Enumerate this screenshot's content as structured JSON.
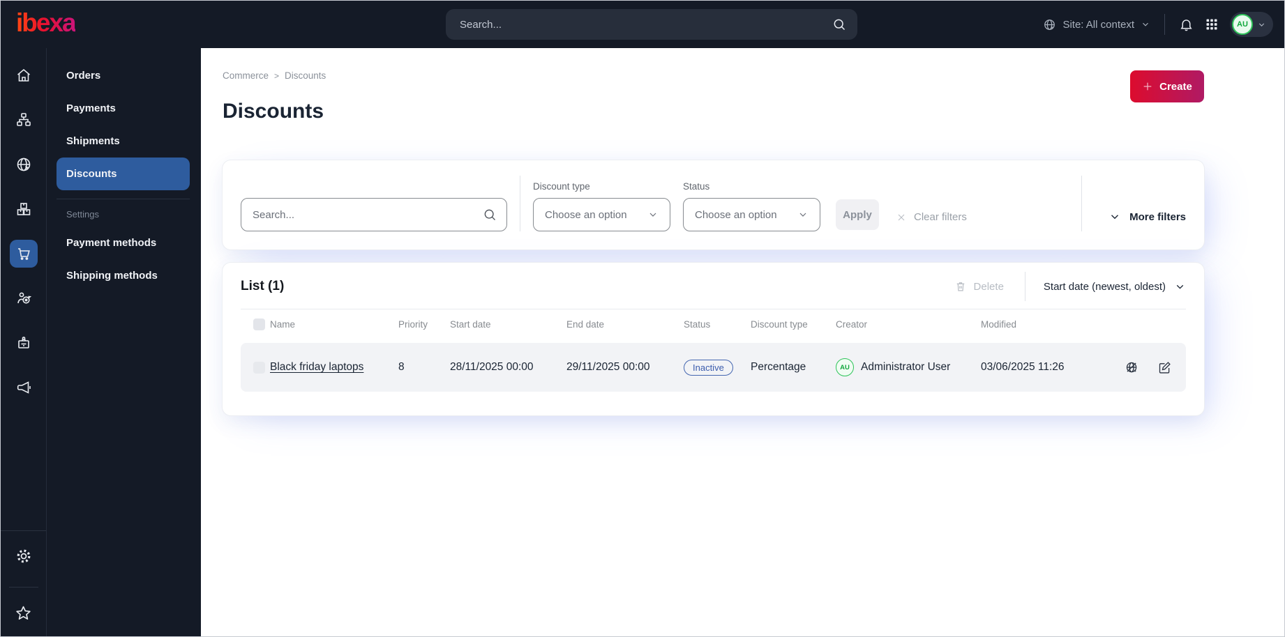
{
  "topbar": {
    "logo": "ibexa",
    "search_placeholder": "Search...",
    "site_context": "Site: All context",
    "avatar_initials": "AU"
  },
  "sidebar": {
    "rail_icons": [
      "home",
      "site-structure",
      "site",
      "products",
      "commerce-cart",
      "customers",
      "personnel-badge",
      "marketing-megaphone",
      "settings-gear",
      "bookmarks-star"
    ],
    "rail_active": "commerce-cart",
    "menu": {
      "items": [
        {
          "label": "Orders",
          "active": false
        },
        {
          "label": "Payments",
          "active": false
        },
        {
          "label": "Shipments",
          "active": false
        },
        {
          "label": "Discounts",
          "active": true
        }
      ],
      "settings_label": "Settings",
      "settings_items": [
        {
          "label": "Payment methods"
        },
        {
          "label": "Shipping methods"
        }
      ]
    }
  },
  "breadcrumb": {
    "items": [
      "Commerce",
      "Discounts"
    ],
    "separator": ">"
  },
  "page": {
    "title": "Discounts",
    "create_label": "Create"
  },
  "filters": {
    "search_placeholder": "Search...",
    "discount_type_label": "Discount type",
    "discount_type_value": "Choose an option",
    "status_label": "Status",
    "status_value": "Choose an option",
    "apply_label": "Apply",
    "clear_label": "Clear filters",
    "more_label": "More filters"
  },
  "list": {
    "title": "List (1)",
    "delete_label": "Delete",
    "sort_label": "Start date (newest, oldest)",
    "columns": [
      "Name",
      "Priority",
      "Start date",
      "End date",
      "Status",
      "Discount type",
      "Creator",
      "Modified"
    ],
    "rows": [
      {
        "name": "Black friday laptops",
        "priority": "8",
        "start_date": "28/11/2025 00:00",
        "end_date": "29/11/2025 00:00",
        "status": "Inactive",
        "discount_type": "Percentage",
        "creator": "Administrator User",
        "creator_initials": "AU",
        "modified": "03/06/2025 11:26",
        "action_icons": [
          "site-hidden",
          "edit"
        ]
      }
    ]
  },
  "colors": {
    "topbar_bg": "#141a26",
    "active_blue": "#2e5c9e",
    "brand_gradient_start": "#dc0c2e",
    "brand_gradient_end": "#b01a64",
    "badge_blue": "#3b5cad",
    "avatar_green": "#2fc45a",
    "row_bg": "#f2f3f6"
  }
}
